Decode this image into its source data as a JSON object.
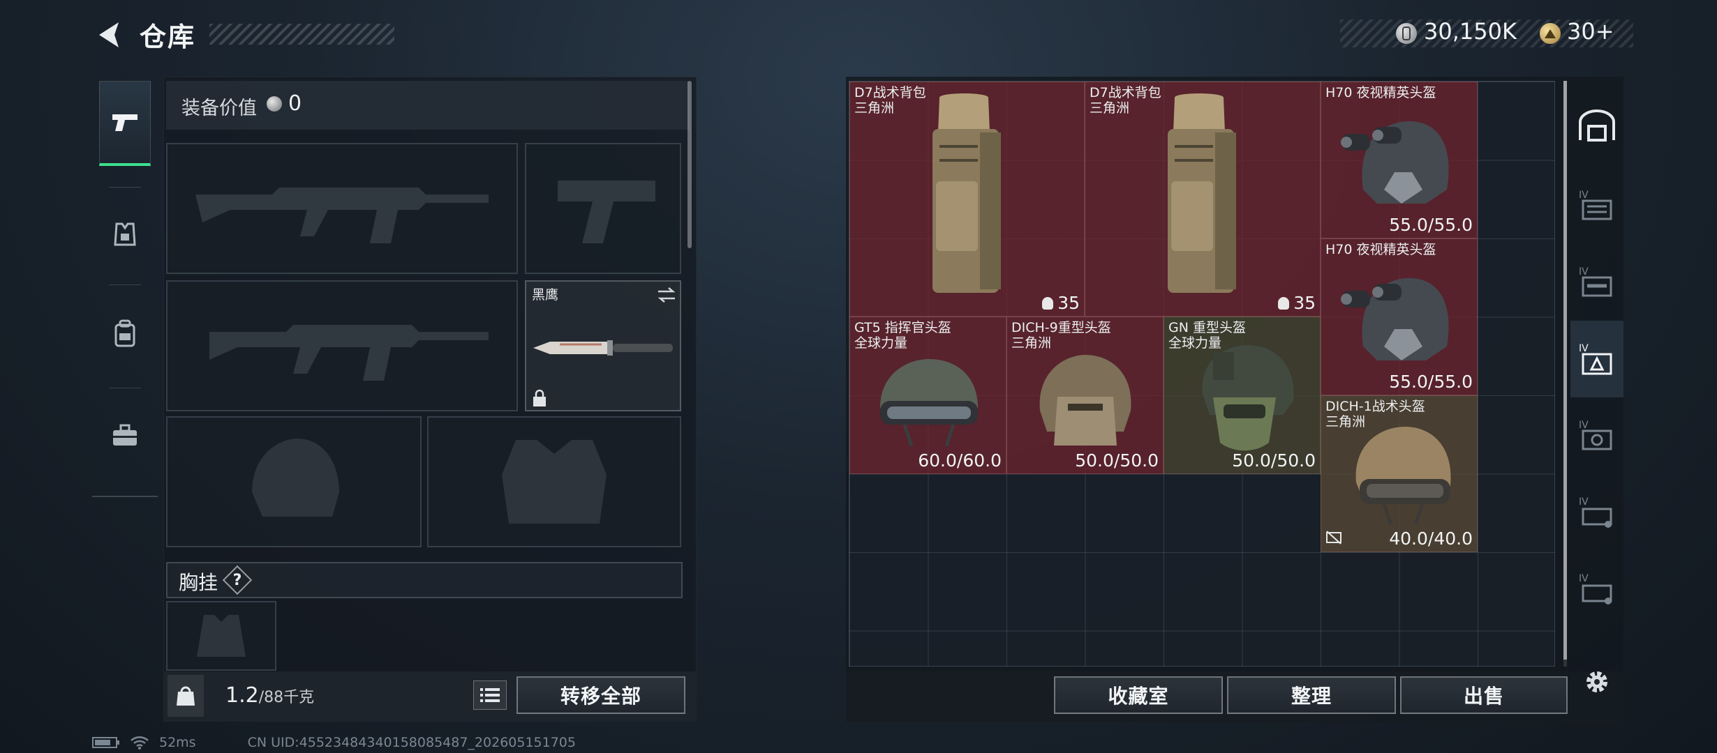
{
  "header": {
    "title": "仓库"
  },
  "currency": {
    "silver": "30,150K",
    "gold": "30+"
  },
  "left_nav": {
    "items": [
      {
        "name": "weapons",
        "icon": "pistol-icon",
        "active": true
      },
      {
        "name": "armor",
        "icon": "armor-icon",
        "active": false
      },
      {
        "name": "backpack",
        "icon": "backpack-icon",
        "active": false
      },
      {
        "name": "tools",
        "icon": "toolbox-icon",
        "active": false
      }
    ]
  },
  "equipment": {
    "value_label": "装备价值",
    "value": "0",
    "knife_name": "黑鹰",
    "chest_label": "胸挂",
    "help": "?"
  },
  "weight": {
    "current": "1.2",
    "max": "/88千克"
  },
  "buttons": {
    "transfer_all": "转移全部",
    "collection": "收藏室",
    "organize": "整理",
    "sell": "出售"
  },
  "inventory": {
    "items": [
      {
        "name": "D7战术背包",
        "sub": "三角洲",
        "capacity": "35",
        "type": "backpack",
        "color": "red"
      },
      {
        "name": "D7战术背包",
        "sub": "三角洲",
        "capacity": "35",
        "type": "backpack",
        "color": "red"
      },
      {
        "name": "H70 夜视精英头盔",
        "sub": "",
        "durability": "55.0/55.0",
        "type": "nvg-helmet",
        "color": "red"
      },
      {
        "name": "H70 夜视精英头盔",
        "sub": "",
        "durability": "55.0/55.0",
        "type": "nvg-helmet",
        "color": "red"
      },
      {
        "name": "GT5 指挥官头盔",
        "sub": "全球力量",
        "durability": "60.0/60.0",
        "type": "helmet",
        "color": "red"
      },
      {
        "name": "DICH-9重型头盔",
        "sub": "三角洲",
        "durability": "50.0/50.0",
        "type": "helmet",
        "color": "red"
      },
      {
        "name": "GN 重型头盔",
        "sub": "全球力量",
        "durability": "50.0/50.0",
        "type": "helmet",
        "color": "green"
      },
      {
        "name": "DICH-1战术头盔",
        "sub": "三角洲",
        "durability": "40.0/40.0",
        "type": "helmet",
        "color": "tan"
      }
    ]
  },
  "status": {
    "ping": "52ms",
    "uid": "CN UID:4552348434015808548​7_202605151705"
  }
}
